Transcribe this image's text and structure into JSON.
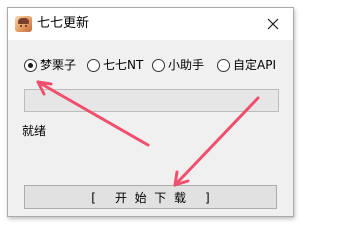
{
  "window": {
    "title": "七七更新",
    "app_icon": "avatar-icon",
    "close_icon": "close-icon"
  },
  "options": [
    {
      "label": "梦栗子",
      "checked": true
    },
    {
      "label": "七七NT",
      "checked": false
    },
    {
      "label": "小助手",
      "checked": false
    },
    {
      "label": "自定API",
      "checked": false
    }
  ],
  "progress": {
    "value": 0
  },
  "status": {
    "text": "就绪"
  },
  "download_button": {
    "label": "[     开  始  下  载     ]"
  },
  "annotation": {
    "arrow_color": "#f0506e"
  }
}
